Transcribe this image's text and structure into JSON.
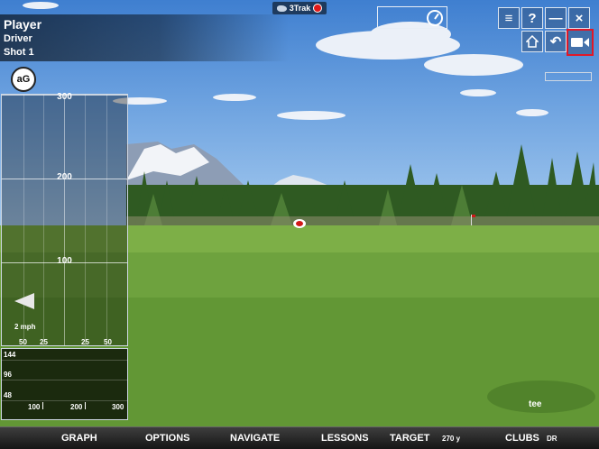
{
  "header": {
    "player_name": "Player",
    "club": "Driver",
    "shot": "Shot 1",
    "brand_text": "3Trak"
  },
  "toolbar": {
    "menu_icon": "≡",
    "help_icon": "?",
    "minimize_icon": "—",
    "close_icon": "×",
    "home_icon": "home-icon",
    "undo_icon": "↶",
    "camera_icon": "camera-icon"
  },
  "ag_logo": "aG",
  "map_panel": {
    "y_labels": [
      "300",
      "200",
      "100"
    ],
    "wind_speed": "2 mph",
    "x_labels": [
      "50",
      "25",
      "25",
      "50"
    ]
  },
  "graph_panel": {
    "y_labels": [
      "144",
      "96",
      "48"
    ],
    "x_labels": [
      "100",
      "200",
      "300"
    ]
  },
  "tee_label": "tee",
  "bottom_menu": {
    "graph": "GRAPH",
    "options": "OPTIONS",
    "navigate": "NAVIGATE",
    "lessons": "LESSONS",
    "target": "TARGET",
    "target_distance": "270 y",
    "clubs": "CLUBS",
    "club_code": "DR"
  },
  "colors": {
    "highlight": "#e01828",
    "record_dot": "#e01818"
  }
}
